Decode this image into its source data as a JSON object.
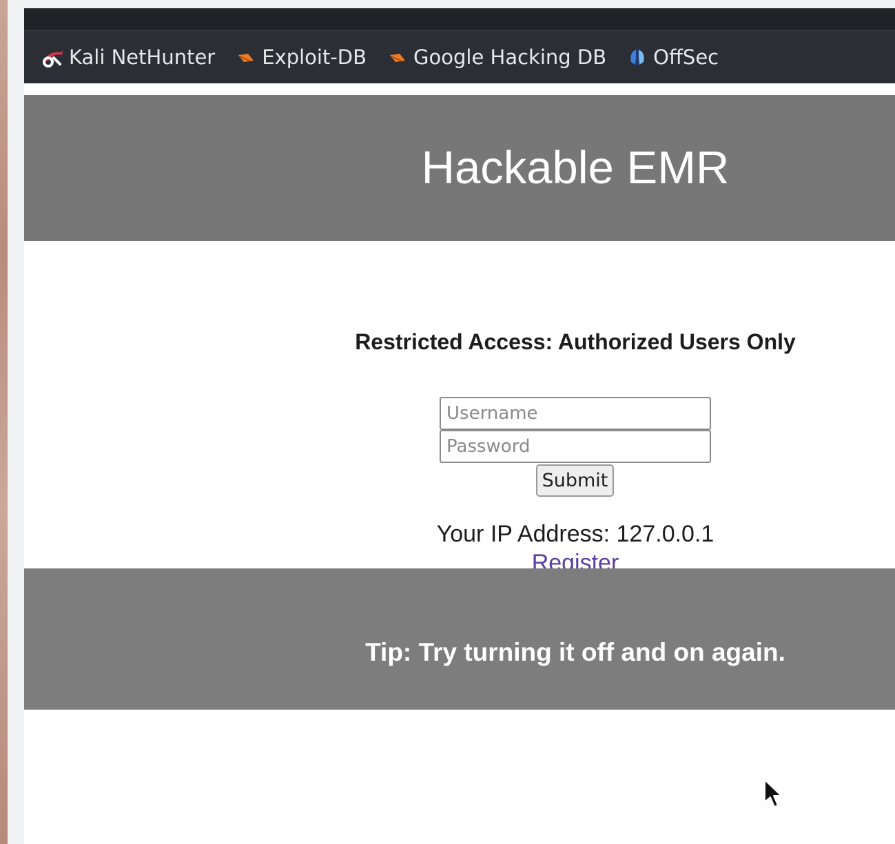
{
  "browser": {
    "bookmarks": [
      {
        "label": "Kali NetHunter",
        "icon": "kali-dragon-icon",
        "color": "#d6344a"
      },
      {
        "label": "Exploit-DB",
        "icon": "exploit-db-icon",
        "color": "#f07b22"
      },
      {
        "label": "Google Hacking DB",
        "icon": "ghdb-icon",
        "color": "#f07b22"
      },
      {
        "label": "OffSec",
        "icon": "offsec-icon",
        "color": "#3f7fe0"
      }
    ]
  },
  "page": {
    "title": "Hackable EMR",
    "notice": "Restricted Access: Authorized Users Only",
    "login": {
      "username_placeholder": "Username",
      "password_placeholder": "Password",
      "submit_label": "Submit"
    },
    "ip_text": "Your IP Address: 127.0.0.1",
    "register_link": "Register",
    "tip": "Tip: Try turning it off and on again."
  },
  "colors": {
    "header_bg": "#777777",
    "footer_bg": "#7d7d7d",
    "bookmark_bar_bg": "#2b2e35",
    "link": "#5a3fa0"
  }
}
